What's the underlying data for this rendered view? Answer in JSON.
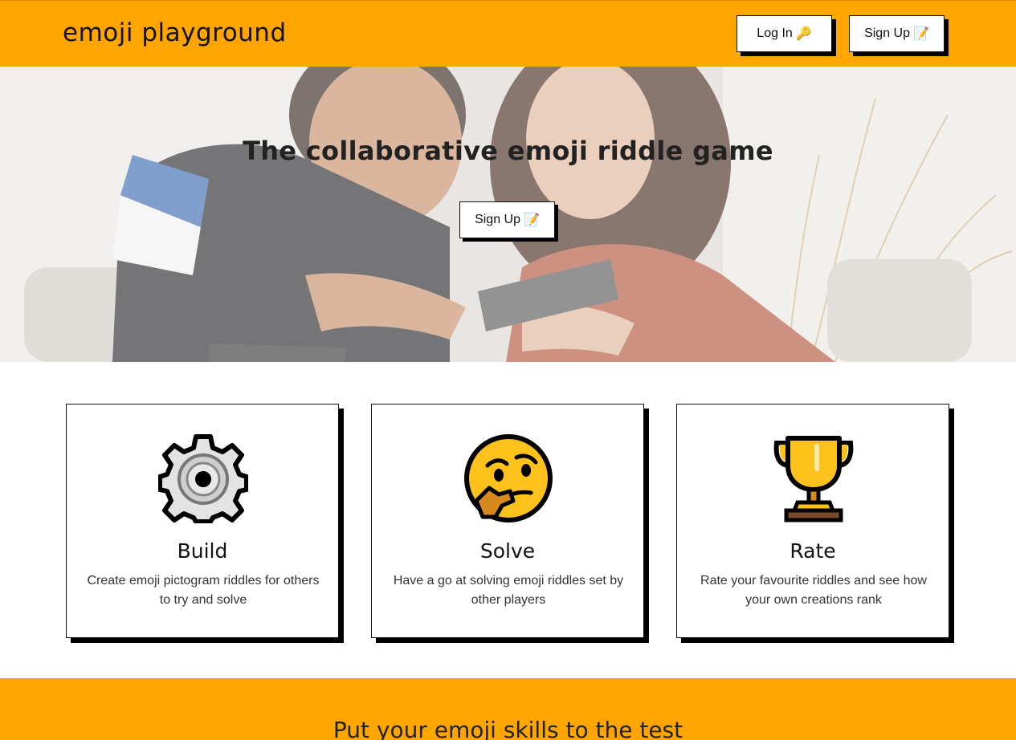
{
  "navbar": {
    "brand": "emoji playground",
    "login_label": "Log In",
    "login_icon": "🔑",
    "signup_label": "Sign Up",
    "signup_icon": "📝",
    "background": "#FFA500"
  },
  "hero": {
    "title": "The collaborative emoji riddle game",
    "cta_label": "Sign Up",
    "cta_icon": "📝",
    "image": "couple-playing-phone-photo"
  },
  "features": [
    {
      "title": "Build",
      "description": "Create emoji pictogram riddles for others to try and solve",
      "icon": "gear-icon"
    },
    {
      "title": "Solve",
      "description": "Have a go at solving emoji riddles set by other players",
      "icon": "thinking-face-icon"
    },
    {
      "title": "Rate",
      "description": "Rate your favourite riddles and see how your own creations rank",
      "icon": "trophy-icon"
    }
  ],
  "band": {
    "title": "Put your emoji skills to the test"
  }
}
